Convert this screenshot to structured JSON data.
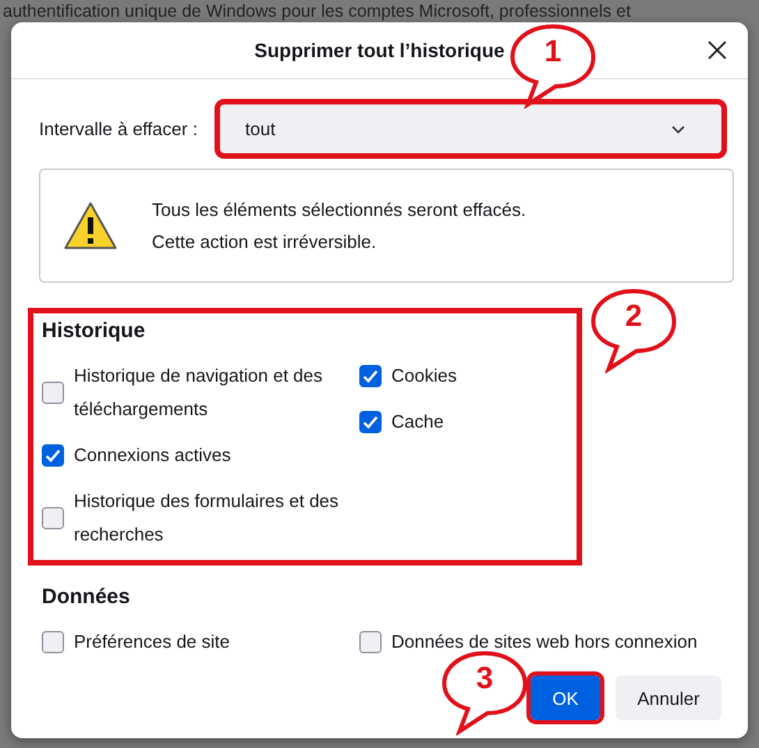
{
  "background": {
    "text": "authentification unique de Windows pour les comptes Microsoft, professionnels et"
  },
  "dialog": {
    "title": "Supprimer tout l’historique",
    "range": {
      "label": "Intervalle à effacer :",
      "value": "tout",
      "highlighted": true
    },
    "warning": [
      "Tous les éléments sélectionnés seront effacés.",
      "Cette action est irréversible."
    ],
    "sections": [
      {
        "title": "Historique",
        "highlighted": true,
        "columns": [
          [
            {
              "label": "Historique de navigation et des téléchargements",
              "checked": false
            },
            {
              "label": "Connexions actives",
              "checked": true
            },
            {
              "label": "Historique des formulaires et des recherches",
              "checked": false
            }
          ],
          [
            {
              "label": "Cookies",
              "checked": true
            },
            {
              "label": "Cache",
              "checked": true
            }
          ]
        ]
      },
      {
        "title": "Données",
        "highlighted": false,
        "columns": [
          [
            {
              "label": "Préférences de site",
              "checked": false
            }
          ],
          [
            {
              "label": "Données de sites web hors connexion",
              "checked": false
            }
          ]
        ]
      }
    ],
    "buttons": [
      {
        "label": "OK",
        "kind": "primary",
        "highlighted": true
      },
      {
        "label": "Annuler",
        "kind": "secondary",
        "highlighted": false
      }
    ]
  },
  "callouts": [
    {
      "label": "1"
    },
    {
      "label": "2"
    },
    {
      "label": "3"
    }
  ]
}
